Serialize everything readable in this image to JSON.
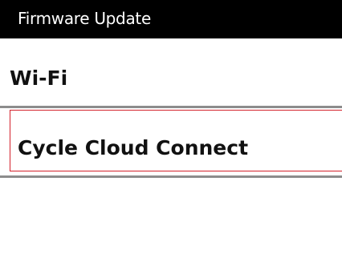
{
  "header": {
    "title": "Firmware Update"
  },
  "menu": {
    "items": [
      {
        "label": "Wi-Fi",
        "selected": false
      },
      {
        "label": "Cycle Cloud Connect",
        "selected": true
      }
    ]
  },
  "colors": {
    "title_bar_bg": "#000000",
    "title_text": "#ffffff",
    "selection_border": "#d4202a",
    "divider": "#8c8c8c"
  }
}
